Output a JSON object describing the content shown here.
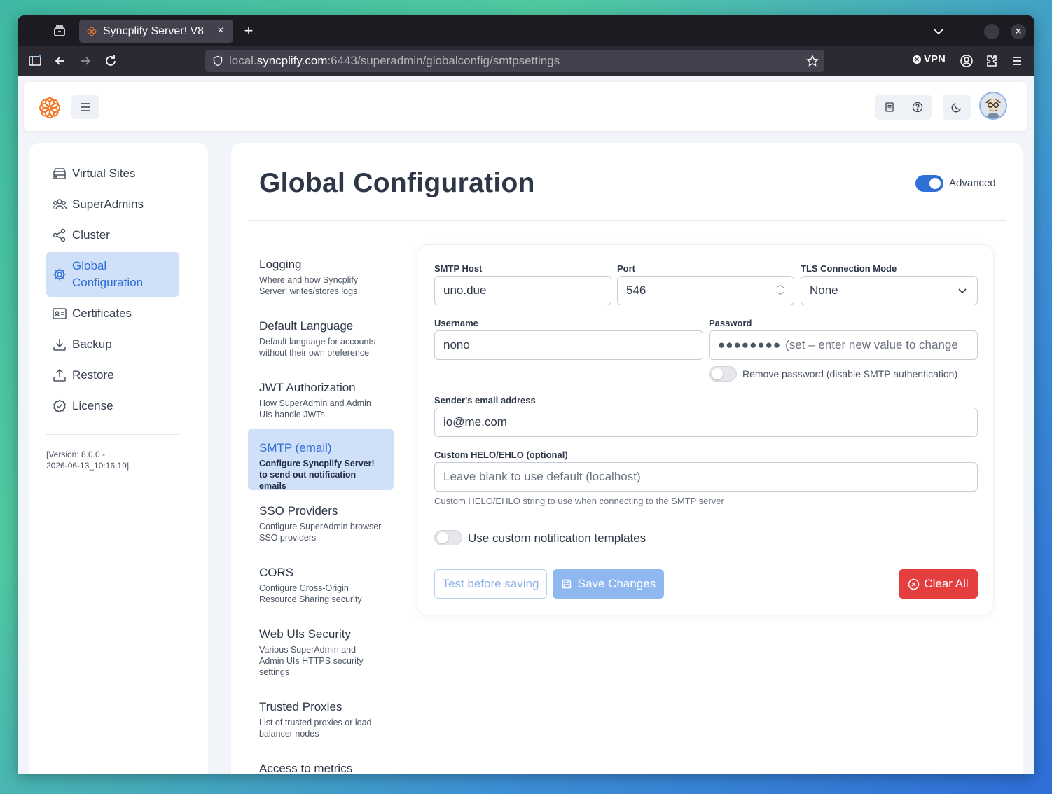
{
  "browser": {
    "tab_title": "Syncplify Server! V8",
    "url_prefix": "local.",
    "url_host": "syncplify.com",
    "url_path": ":6443/superadmin/globalconfig/smtpsettings",
    "vpn_label": "VPN"
  },
  "sidebar": {
    "items": [
      {
        "label": "Virtual Sites",
        "icon": "server-icon"
      },
      {
        "label": "SuperAdmins",
        "icon": "users-icon"
      },
      {
        "label": "Cluster",
        "icon": "share-icon"
      },
      {
        "label": "Global Configuration",
        "icon": "gear-icon",
        "active": true
      },
      {
        "label": "Certificates",
        "icon": "id-card-icon"
      },
      {
        "label": "Backup",
        "icon": "download-icon"
      },
      {
        "label": "Restore",
        "icon": "upload-icon"
      },
      {
        "label": "License",
        "icon": "badge-check-icon"
      }
    ],
    "version_line1": "[Version: 8.0.0 -",
    "version_line2": "2026-06-13_10:16:19]"
  },
  "main": {
    "title": "Global Configuration",
    "advanced_label": "Advanced",
    "advanced_on": true
  },
  "menu": [
    {
      "title": "Logging",
      "desc": "Where and how Syncplify Server! writes/stores logs"
    },
    {
      "title": "Default Language",
      "desc": "Default language for accounts without their own preference"
    },
    {
      "title": "JWT Authorization",
      "desc": "How SuperAdmin and Admin UIs handle JWTs"
    },
    {
      "title": "SMTP (email)",
      "desc": "Configure Syncplify Server! to send out notification emails",
      "active": true
    },
    {
      "title": "SSO Providers",
      "desc": "Configure SuperAdmin browser SSO providers"
    },
    {
      "title": "CORS",
      "desc": "Configure Cross-Origin Resource Sharing security"
    },
    {
      "title": "Web UIs Security",
      "desc": "Various SuperAdmin and Admin UIs HTTPS security settings"
    },
    {
      "title": "Trusted Proxies",
      "desc": "List of trusted proxies or load-balancer nodes"
    },
    {
      "title": "Access to metrics",
      "desc": ""
    }
  ],
  "form": {
    "smtp_host_label": "SMTP Host",
    "smtp_host_value": "uno.due",
    "port_label": "Port",
    "port_value": "546",
    "tls_label": "TLS Connection Mode",
    "tls_value": "None",
    "username_label": "Username",
    "username_value": "nono",
    "password_label": "Password",
    "password_dots": "●●●●●●●●",
    "password_hint": "(set – enter new value to change",
    "remove_password_label": "Remove password (disable SMTP authentication)",
    "sender_label": "Sender's email address",
    "sender_value": "io@me.com",
    "helo_label": "Custom HELO/EHLO (optional)",
    "helo_placeholder": "Leave blank to use default (localhost)",
    "helo_help": "Custom HELO/EHLO string to use when connecting to the SMTP server",
    "custom_templates_label": "Use custom notification templates",
    "test_button": "Test before saving",
    "save_button": "Save Changes",
    "clear_button": "Clear All"
  },
  "colors": {
    "accent": "#2f6fd8",
    "active_bg": "#d0e0f8",
    "danger": "#e53e3e",
    "logo": "#f07a2b"
  }
}
